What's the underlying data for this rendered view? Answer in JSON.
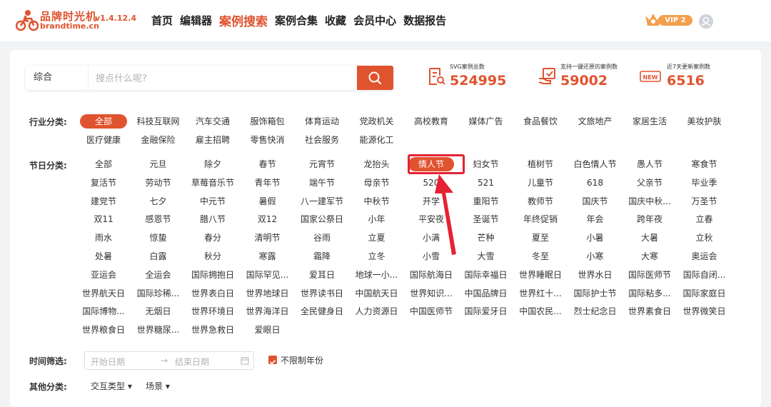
{
  "header": {
    "logo_cn": "品牌时光机",
    "logo_en": "brandtime.cn",
    "version": "v1.4.12.4",
    "nav": [
      {
        "label": "首页"
      },
      {
        "label": "编辑器"
      },
      {
        "label": "案例搜索",
        "active": true
      },
      {
        "label": "案例合集"
      },
      {
        "label": "收藏"
      },
      {
        "label": "会员中心"
      },
      {
        "label": "数据报告"
      }
    ],
    "vip_label": "VIP 2"
  },
  "search": {
    "type": "综合",
    "placeholder": "搜点什么呢?"
  },
  "stats": [
    {
      "label": "SVG案例总数",
      "value": "524995",
      "icon": "document-search-icon"
    },
    {
      "label": "支持一键还原的案例数",
      "value": "59002",
      "icon": "restore-hand-icon"
    },
    {
      "label": "近7天更新案例数",
      "value": "6516",
      "icon": "new-badge-icon"
    }
  ],
  "industry": {
    "label": "行业分类:",
    "tags": [
      "全部",
      "科技互联网",
      "汽车交通",
      "服饰箱包",
      "体育运动",
      "党政机关",
      "高校教育",
      "媒体广告",
      "食品餐饮",
      "文旅地产",
      "家居生活",
      "美妆护肤",
      "医疗健康",
      "金融保险",
      "雇主招聘",
      "零售快消",
      "社会服务",
      "能源化工"
    ],
    "selected": "全部"
  },
  "holiday": {
    "label": "节日分类:",
    "tags": [
      "全部",
      "元旦",
      "除夕",
      "春节",
      "元宵节",
      "龙抬头",
      "情人节",
      "妇女节",
      "植树节",
      "白色情人节",
      "愚人节",
      "寒食节",
      "复活节",
      "劳动节",
      "草莓音乐节",
      "青年节",
      "端午节",
      "母亲节",
      "520",
      "521",
      "儿童节",
      "618",
      "父亲节",
      "毕业季",
      "建党节",
      "七夕",
      "中元节",
      "暑假",
      "八一建军节",
      "中秋节",
      "开学",
      "重阳节",
      "教师节",
      "国庆节",
      "国庆中秋...",
      "万圣节",
      "双11",
      "感恩节",
      "腊八节",
      "双12",
      "国家公祭日",
      "小年",
      "平安夜",
      "圣诞节",
      "年终促销",
      "年会",
      "跨年夜",
      "立春",
      "雨水",
      "惊蛰",
      "春分",
      "清明节",
      "谷雨",
      "立夏",
      "小满",
      "芒种",
      "夏至",
      "小暑",
      "大暑",
      "立秋",
      "处暑",
      "白露",
      "秋分",
      "寒露",
      "霜降",
      "立冬",
      "小雪",
      "大雪",
      "冬至",
      "小寒",
      "大寒",
      "奥运会",
      "亚运会",
      "全运会",
      "国际拥抱日",
      "国际罕见...",
      "爱耳日",
      "地球一小...",
      "国际航海日",
      "国际幸福日",
      "世界睡眠日",
      "世界水日",
      "国际医师节",
      "国际自闭...",
      "世界航天日",
      "国际珍稀...",
      "世界表白日",
      "世界地球日",
      "世界读书日",
      "中国航天日",
      "世界知识...",
      "中国品牌日",
      "世界红十...",
      "国际护士节",
      "国际粘多...",
      "国际家庭日",
      "国际博物...",
      "无烟日",
      "世界环境日",
      "世界海洋日",
      "全民健身日",
      "人力资源日",
      "中国医师节",
      "国际爱牙日",
      "中国农民...",
      "烈士纪念日",
      "世界素食日",
      "世界微笑日",
      "世界粮食日",
      "世界糖尿...",
      "世界急救日",
      "爱眼日"
    ],
    "selected": "情人节"
  },
  "time_filter": {
    "label": "时间筛选:",
    "start_placeholder": "开始日期",
    "separator": "→",
    "end_placeholder": "结束日期",
    "unlimited_label": "不限制年份",
    "unlimited_checked": true
  },
  "other": {
    "label": "其他分类:",
    "dropdowns": [
      "交互类型 ▾",
      "场景 ▾"
    ]
  },
  "colors": {
    "accent": "#e0532f",
    "highlight_border": "#e52233"
  }
}
